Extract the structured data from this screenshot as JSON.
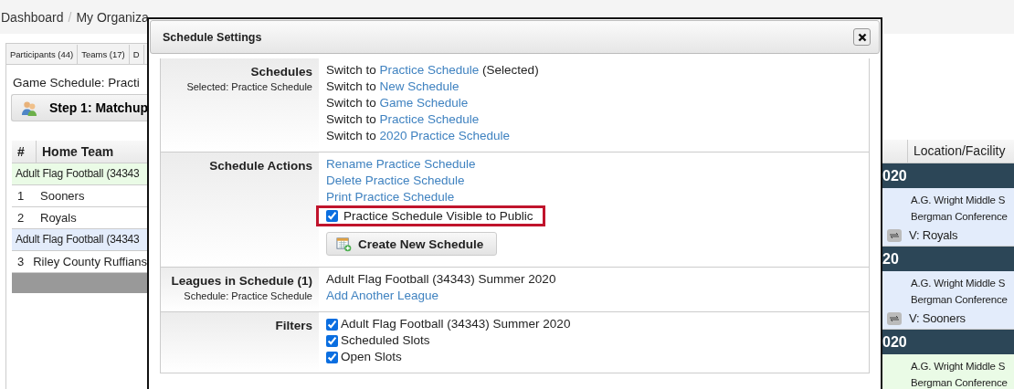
{
  "breadcrumb": {
    "items": [
      "Dashboard",
      "My Organiza"
    ],
    "separator": "/"
  },
  "tabs": [
    {
      "label": "Participants (44)",
      "selected": false
    },
    {
      "label": "Teams (17)",
      "selected": false
    },
    {
      "label": "D",
      "selected": false
    }
  ],
  "schedule_title": "Game Schedule: Practi",
  "step_button": "Step 1: Matchup",
  "table": {
    "columns": [
      "#",
      "Home Team"
    ],
    "rows": [
      {
        "kind": "group",
        "text": "Adult Flag Football (34343",
        "color": "#eafbe6"
      },
      {
        "kind": "team",
        "num": "1",
        "team": "Sooners"
      },
      {
        "kind": "team",
        "num": "2",
        "team": "Royals"
      },
      {
        "kind": "group",
        "text": "Adult Flag Football (34343",
        "color": "#e3ecfb"
      },
      {
        "kind": "team",
        "num": "3",
        "team": "Riley County Ruffians"
      }
    ]
  },
  "right_table": {
    "column": "Location/Facility",
    "blocks": [
      {
        "date": "020",
        "lines": [
          "A.G. Wright Middle S",
          "Bergman Conference"
        ],
        "visitor": "V: Royals",
        "color": "#e3ecfb"
      },
      {
        "date": "20",
        "lines": [
          "A.G. Wright Middle S",
          "Bergman Conference"
        ],
        "visitor": "V: Sooners",
        "color": "#e3ecfb"
      },
      {
        "date": "020",
        "lines": [
          "A.G. Wright Middle S",
          "Bergman Conference"
        ],
        "color": "#eafbe6"
      }
    ]
  },
  "dialog": {
    "title": "Schedule Settings",
    "sections": [
      {
        "kind": "links",
        "label": "Schedules",
        "sublabel": "Selected: Practice Schedule",
        "items": [
          {
            "prefix": "Switch to",
            "link": "Practice Schedule",
            "suffix": "(Selected)"
          },
          {
            "prefix": "Switch to",
            "link": "New Schedule"
          },
          {
            "prefix": "Switch to",
            "link": "Game Schedule"
          },
          {
            "prefix": "Switch to",
            "link": "Practice Schedule"
          },
          {
            "prefix": "Switch to",
            "link": "2020 Practice Schedule"
          }
        ]
      },
      {
        "kind": "actions",
        "label": "Schedule Actions",
        "links": [
          "Rename Practice Schedule",
          "Delete Practice Schedule",
          "Print Practice Schedule"
        ],
        "visible_checkbox": {
          "label": "Practice Schedule Visible to Public",
          "checked": true,
          "highlighted": true
        },
        "button": "Create New Schedule"
      },
      {
        "kind": "leagues",
        "label": "Leagues in Schedule (1)",
        "sublabel": "Schedule: Practice Schedule",
        "text": "Adult Flag Football (34343) Summer 2020",
        "link": "Add Another League"
      },
      {
        "kind": "filters",
        "label": "Filters",
        "checks": [
          {
            "label": "Adult Flag Football (34343) Summer 2020",
            "checked": true
          },
          {
            "label": "Scheduled Slots",
            "checked": true
          },
          {
            "label": "Open Slots",
            "checked": true
          }
        ]
      }
    ]
  }
}
